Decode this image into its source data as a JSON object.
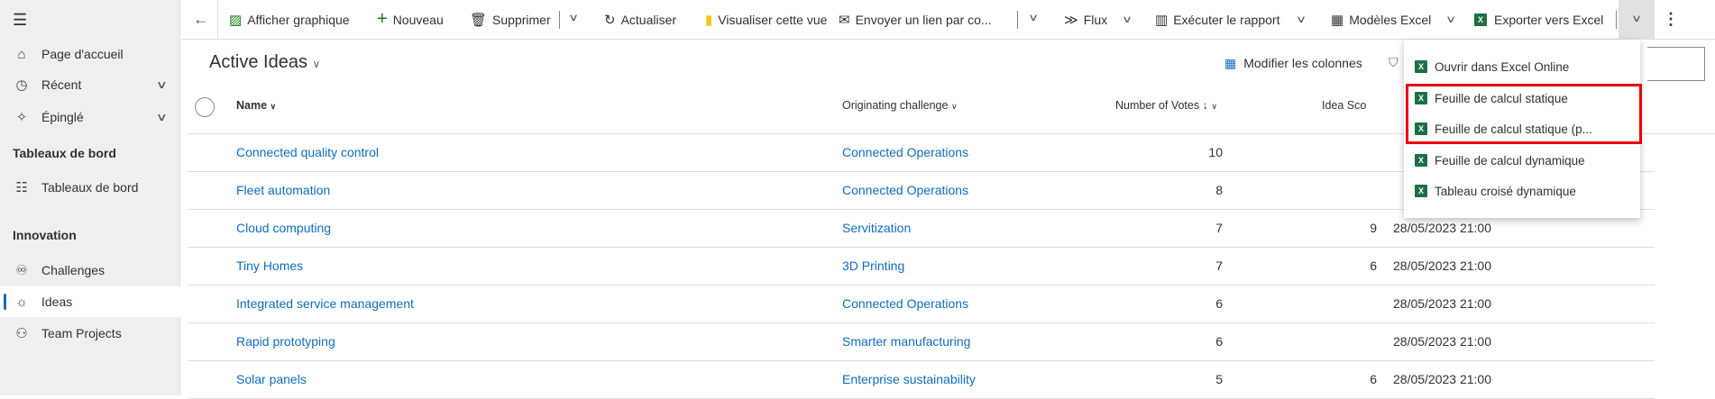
{
  "sidebar": {
    "items": [
      {
        "label": "Page d'accueil",
        "icon": "home-icon"
      },
      {
        "label": "Récent",
        "icon": "clock-icon"
      },
      {
        "label": "Épinglé",
        "icon": "pin-icon"
      }
    ],
    "section1": "Tableaux de bord",
    "dashboards": "Tableaux de bord",
    "section2": "Innovation",
    "innovation": [
      {
        "label": "Challenges"
      },
      {
        "label": "Ideas"
      },
      {
        "label": "Team Projects"
      }
    ]
  },
  "toolbar": {
    "show_chart": "Afficher graphique",
    "new": "Nouveau",
    "delete": "Supprimer",
    "refresh": "Actualiser",
    "visualize": "Visualiser cette vue",
    "email_link": "Envoyer un lien par co...",
    "flow": "Flux",
    "run_report": "Exécuter le rapport",
    "excel_templates": "Modèles Excel",
    "export_excel": "Exporter vers Excel"
  },
  "view": {
    "title": "Active Ideas",
    "edit_columns": "Modifier les colonnes"
  },
  "table": {
    "headers": {
      "name": "Name",
      "challenge": "Originating challenge",
      "votes": "Number of Votes",
      "score": "Idea Sco"
    },
    "rows": [
      {
        "name": "Connected quality control",
        "challenge": "Connected Operations",
        "votes": "10",
        "score": "",
        "date": ""
      },
      {
        "name": "Fleet automation",
        "challenge": "Connected Operations",
        "votes": "8",
        "score": "",
        "date": ""
      },
      {
        "name": "Cloud computing",
        "challenge": "Servitization",
        "votes": "7",
        "score": "9",
        "date": "28/05/2023 21:00"
      },
      {
        "name": "Tiny Homes",
        "challenge": "3D Printing",
        "votes": "7",
        "score": "6",
        "date": "28/05/2023 21:00"
      },
      {
        "name": "Integrated service management",
        "challenge": "Connected Operations",
        "votes": "6",
        "score": "",
        "date": "28/05/2023 21:00"
      },
      {
        "name": "Rapid prototyping",
        "challenge": "Smarter manufacturing",
        "votes": "6",
        "score": "",
        "date": "28/05/2023 21:00"
      },
      {
        "name": "Solar panels",
        "challenge": "Enterprise sustainability",
        "votes": "5",
        "score": "6",
        "date": "28/05/2023 21:00"
      }
    ]
  },
  "export_menu": {
    "items": [
      "Ouvrir dans Excel Online",
      "Feuille de calcul statique",
      "Feuille de calcul statique (p...",
      "Feuille de calcul dynamique",
      "Tableau croisé dynamique"
    ],
    "highlight_color": "#e8000b"
  }
}
